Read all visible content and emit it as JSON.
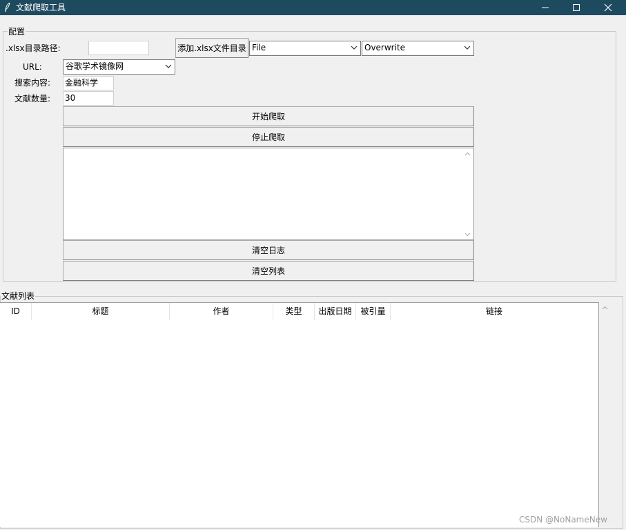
{
  "window": {
    "title": "文献爬取工具",
    "icon": "feather-icon",
    "controls": [
      "minimize-icon",
      "maximize-icon",
      "close-icon"
    ]
  },
  "config": {
    "group_label": "配置",
    "xlsx_path_label": ".xlsx目录路径:",
    "xlsx_path_value": "",
    "add_xlsx_button": "添加.xlsx文件目录",
    "file_select": "File",
    "mode_select": "Overwrite",
    "url_label": "URL:",
    "url_select": "谷歌学术镜像网",
    "search_label": "搜索内容:",
    "search_value": "金融科学",
    "count_label": "文献数量:",
    "count_value": "30",
    "start_button": "开始爬取",
    "stop_button": "停止爬取",
    "log_text": "",
    "clear_log_button": "清空日志",
    "clear_list_button": "清空列表"
  },
  "list": {
    "group_label": "文献列表",
    "columns": [
      "ID",
      "标题",
      "作者",
      "类型",
      "出版日期",
      "被引量",
      "链接"
    ],
    "rows": []
  },
  "watermark": "CSDN @NoNameNew"
}
